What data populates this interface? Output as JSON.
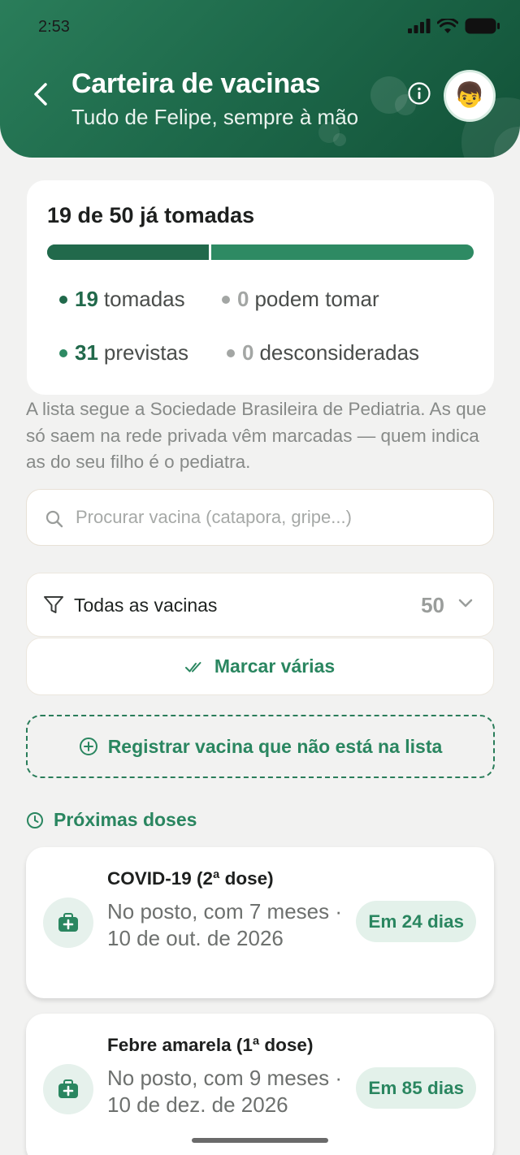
{
  "status_bar": {
    "time": "2:53"
  },
  "header": {
    "title": "Carteira de vacinas",
    "subtitle": "Tudo de Felipe, sempre à mão",
    "avatar_emoji": "👦"
  },
  "summary": {
    "title": "19 de 50 já tomadas",
    "progress": {
      "taken": 19,
      "total": 50
    },
    "stats": [
      {
        "num": "19",
        "label": "tomadas",
        "color": "#21694b"
      },
      {
        "num": "0",
        "label": "podem tomar",
        "color": "#a3a6a4"
      },
      {
        "num": "31",
        "label": "previstas",
        "color": "#2e8a63"
      },
      {
        "num": "0",
        "label": "desconsideradas",
        "color": "#a3a6a4"
      }
    ]
  },
  "note": "A lista segue a Sociedade Brasileira de Pediatria. As que só saem na rede privada vêm marcadas — quem indica as do seu filho é o pediatra.",
  "search": {
    "placeholder": "Procurar vacina (catapora, gripe...)",
    "value": ""
  },
  "filter": {
    "label": "Todas as vacinas",
    "count": "50"
  },
  "actions": {
    "mark_multiple": "Marcar várias",
    "register_other": "Registrar vacina que não está na lista"
  },
  "upcoming": {
    "section_title": "Próximas doses",
    "items": [
      {
        "name": "COVID-19 (2ª dose)",
        "detail": "No posto, com 7 meses · 10 de out. de 2026",
        "badge": "Em 24 dias"
      },
      {
        "name": "Febre amarela (1ª dose)",
        "detail": "No posto, com 9 meses · 10 de dez. de 2026",
        "badge": "Em 85 dias"
      }
    ]
  },
  "colors": {
    "brand_dark": "#1e6a4b",
    "brand": "#2a8660",
    "badge_bg": "#e3f1ea"
  }
}
